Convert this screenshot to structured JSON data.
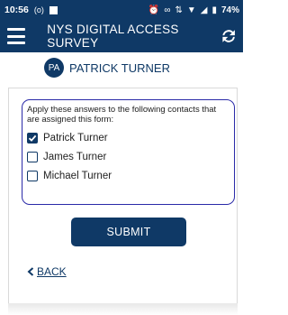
{
  "status": {
    "time": "10:56",
    "signal_text": "(o)",
    "battery": "74%"
  },
  "appbar": {
    "title": "NYS DIGITAL ACCESS SURVEY",
    "menu_icon": "hamburger-menu-icon",
    "refresh_icon": "refresh-icon"
  },
  "user": {
    "initials": "PA",
    "name": "PATRICK TURNER"
  },
  "form": {
    "instructions": "Apply these answers to the following contacts that are assigned this form:",
    "contacts": [
      {
        "label": "Patrick Turner",
        "checked": true
      },
      {
        "label": "James Turner",
        "checked": false
      },
      {
        "label": "Michael Turner",
        "checked": false
      }
    ],
    "submit_label": "SUBMIT",
    "back_label": "BACK"
  },
  "colors": {
    "primary": "#0f3966",
    "card_border": "#2a2aa8"
  }
}
